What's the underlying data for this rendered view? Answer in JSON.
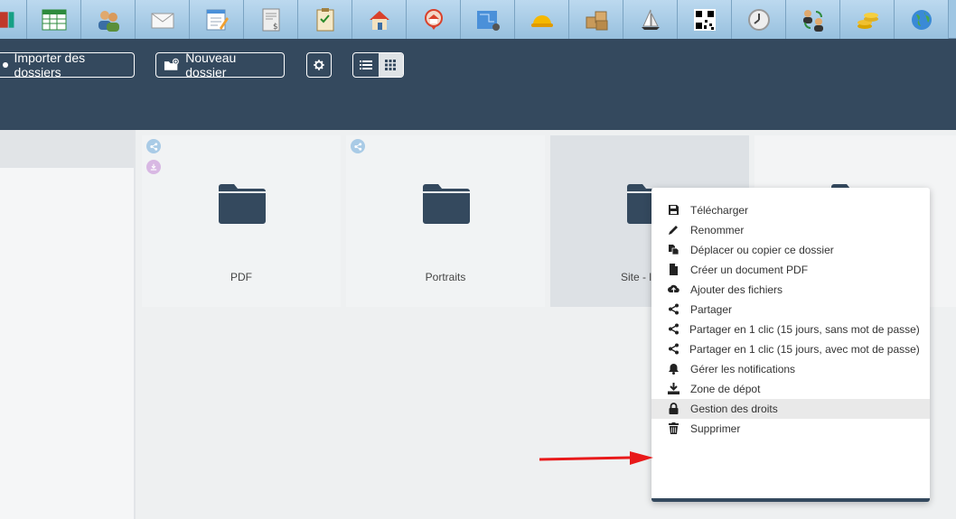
{
  "iconbar": {
    "icons": [
      "app-partial-icon",
      "spreadsheet-icon",
      "users-icon",
      "mail-icon",
      "notepad-icon",
      "invoice-icon",
      "checklist-icon",
      "house-icon",
      "house-location-icon",
      "blueprint-icon",
      "hard-hat-icon",
      "boxes-icon",
      "sailboat-icon",
      "qr-code-icon",
      "clock-icon",
      "user-exchange-icon",
      "coins-icon",
      "globe-icon"
    ]
  },
  "toolbar": {
    "import_label": "Importer des dossiers",
    "new_folder_label": "Nouveau dossier"
  },
  "tiles": [
    {
      "label": "PDF"
    },
    {
      "label": "Portraits"
    },
    {
      "label": "Site - l"
    }
  ],
  "context_menu": {
    "items": [
      {
        "label": "Télécharger",
        "icon": "save-icon"
      },
      {
        "label": "Renommer",
        "icon": "pencil-icon"
      },
      {
        "label": "Déplacer ou copier ce dossier",
        "icon": "copy-icon"
      },
      {
        "label": "Créer un document PDF",
        "icon": "file-icon"
      },
      {
        "label": "Ajouter des fichiers",
        "icon": "cloud-upload-icon"
      },
      {
        "label": "Partager",
        "icon": "share-icon"
      },
      {
        "label": "Partager en 1 clic (15 jours, sans mot de passe)",
        "icon": "share-icon"
      },
      {
        "label": "Partager en 1 clic (15 jours, avec mot de passe)",
        "icon": "share-icon"
      },
      {
        "label": "Gérer les notifications",
        "icon": "bell-icon"
      },
      {
        "label": "Zone de dépot",
        "icon": "download-icon"
      },
      {
        "label": "Gestion des droits",
        "icon": "lock-icon"
      },
      {
        "label": "Supprimer",
        "icon": "trash-icon"
      }
    ],
    "selected_index": 10
  },
  "colors": {
    "toolbar_bg": "#34495e",
    "folder": "#34495e",
    "arrow": "#e8191a",
    "menu_hover": "#e9e9e9"
  }
}
